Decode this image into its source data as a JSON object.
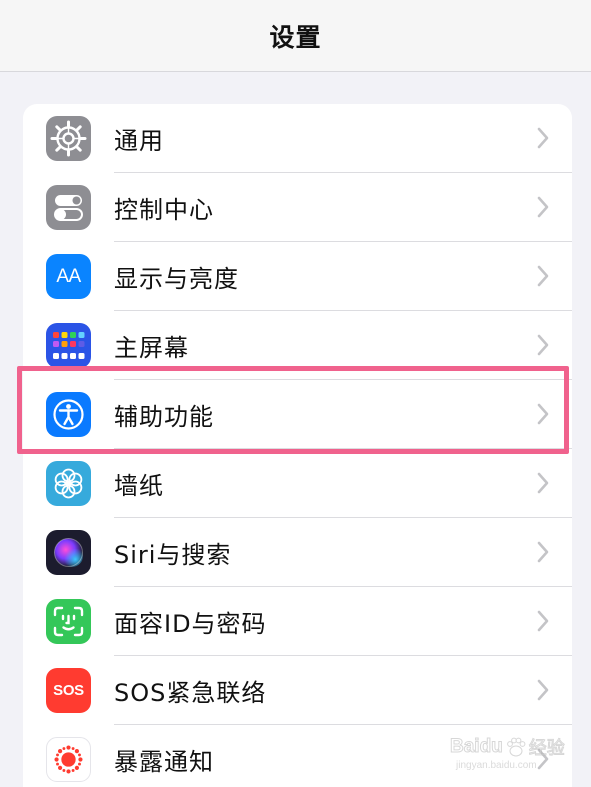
{
  "header": {
    "title": "设置"
  },
  "items": [
    {
      "label": "通用",
      "icon": "gear-icon",
      "color": "#8e8e93"
    },
    {
      "label": "控制中心",
      "icon": "toggles-icon",
      "color": "#8e8e93"
    },
    {
      "label": "显示与亮度",
      "icon": "text-size-icon",
      "color": "#0a84ff"
    },
    {
      "label": "主屏幕",
      "icon": "home-screen-grid-icon",
      "color": "#2b54e6"
    },
    {
      "label": "辅助功能",
      "icon": "accessibility-icon",
      "color": "#0a7aff"
    },
    {
      "label": "墙纸",
      "icon": "wallpaper-flower-icon",
      "color": "#36aadc"
    },
    {
      "label": "Siri与搜索",
      "icon": "siri-icon",
      "color": "#1c1c2e"
    },
    {
      "label": "面容ID与密码",
      "icon": "face-id-icon",
      "color": "#34c759"
    },
    {
      "label": "SOS紧急联络",
      "icon": "sos-icon",
      "color": "#ff3b30"
    },
    {
      "label": "暴露通知",
      "icon": "exposure-notification-icon",
      "color": "#ff3b30"
    }
  ],
  "icon_text": {
    "text_size": "AA",
    "sos": "SOS"
  },
  "watermark": {
    "brand": "Baidu",
    "suffix": "经验",
    "url": "jingyan.baidu.com"
  },
  "highlight_color": "#f0628d"
}
